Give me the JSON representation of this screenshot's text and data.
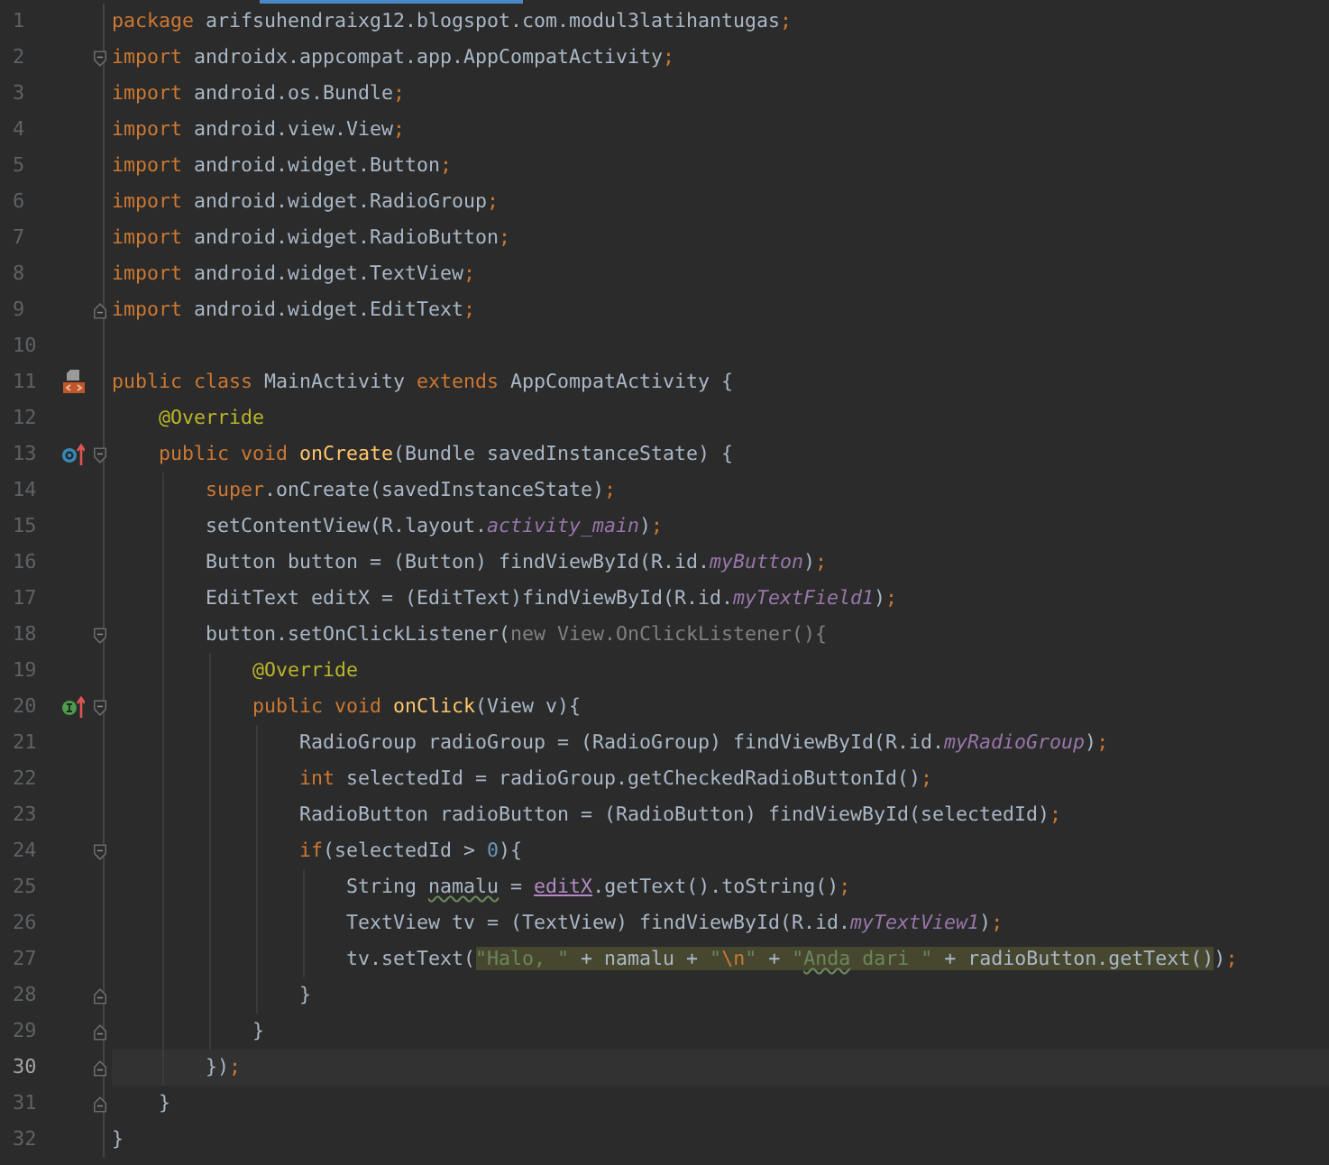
{
  "editor": {
    "lines": [
      {
        "number": "1",
        "tokens": [
          {
            "text": "package",
            "kind": "keyword"
          },
          {
            "text": " arifsuhendraixg12.blogspot.com.modul3latihantugas",
            "kind": "plain"
          },
          {
            "text": ";",
            "kind": "keyword"
          }
        ]
      },
      {
        "number": "2",
        "fold": {
          "kind": "start"
        },
        "tokens": [
          {
            "text": "import",
            "kind": "keyword"
          },
          {
            "text": " androidx.appcompat.app.AppCompatActivity",
            "kind": "plain"
          },
          {
            "text": ";",
            "kind": "keyword"
          }
        ]
      },
      {
        "number": "3",
        "tokens": [
          {
            "text": "import",
            "kind": "keyword"
          },
          {
            "text": " android.os.Bundle",
            "kind": "plain"
          },
          {
            "text": ";",
            "kind": "keyword"
          }
        ]
      },
      {
        "number": "4",
        "tokens": [
          {
            "text": "import",
            "kind": "keyword"
          },
          {
            "text": " android.view.View",
            "kind": "plain"
          },
          {
            "text": ";",
            "kind": "keyword"
          }
        ]
      },
      {
        "number": "5",
        "tokens": [
          {
            "text": "import",
            "kind": "keyword"
          },
          {
            "text": " android.widget.Button",
            "kind": "plain"
          },
          {
            "text": ";",
            "kind": "keyword"
          }
        ]
      },
      {
        "number": "6",
        "tokens": [
          {
            "text": "import",
            "kind": "keyword"
          },
          {
            "text": " android.widget.RadioGroup",
            "kind": "plain"
          },
          {
            "text": ";",
            "kind": "keyword"
          }
        ]
      },
      {
        "number": "7",
        "tokens": [
          {
            "text": "import",
            "kind": "keyword"
          },
          {
            "text": " android.widget.RadioButton",
            "kind": "plain"
          },
          {
            "text": ";",
            "kind": "keyword"
          }
        ]
      },
      {
        "number": "8",
        "tokens": [
          {
            "text": "import",
            "kind": "keyword"
          },
          {
            "text": " android.widget.TextView",
            "kind": "plain"
          },
          {
            "text": ";",
            "kind": "keyword"
          }
        ]
      },
      {
        "number": "9",
        "fold": {
          "kind": "end"
        },
        "tokens": [
          {
            "text": "import",
            "kind": "keyword"
          },
          {
            "text": " android.widget.EditText",
            "kind": "plain"
          },
          {
            "text": ";",
            "kind": "keyword"
          }
        ]
      },
      {
        "number": "10"
      },
      {
        "number": "11",
        "marker": {
          "kind": "layout"
        },
        "tokens": [
          {
            "text": "public class ",
            "kind": "keyword"
          },
          {
            "text": "MainActivity ",
            "kind": "plain"
          },
          {
            "text": "extends ",
            "kind": "keyword"
          },
          {
            "text": "AppCompatActivity {",
            "kind": "plain"
          }
        ]
      },
      {
        "number": "12",
        "tokens": [
          {
            "text": "    @Override",
            "kind": "annotation"
          }
        ]
      },
      {
        "number": "13",
        "marker": {
          "kind": "override"
        },
        "fold": {
          "kind": "start"
        },
        "tokens": [
          {
            "text": "    public void ",
            "kind": "keyword"
          },
          {
            "text": "onCreate",
            "kind": "method"
          },
          {
            "text": "(Bundle savedInstanceState) {",
            "kind": "plain"
          }
        ]
      },
      {
        "number": "14",
        "tokens": [
          {
            "text": "        super",
            "kind": "keyword"
          },
          {
            "text": ".onCreate(savedInstanceState)",
            "kind": "plain"
          },
          {
            "text": ";",
            "kind": "keyword"
          }
        ]
      },
      {
        "number": "15",
        "tokens": [
          {
            "text": "        setContentView(R.layout.",
            "kind": "plain"
          },
          {
            "text": "activity_main",
            "kind": "field"
          },
          {
            "text": ")",
            "kind": "plain"
          },
          {
            "text": ";",
            "kind": "keyword"
          }
        ]
      },
      {
        "number": "16",
        "tokens": [
          {
            "text": "        Button button = (Button) findViewById(R.id.",
            "kind": "plain"
          },
          {
            "text": "myButton",
            "kind": "field"
          },
          {
            "text": ")",
            "kind": "plain"
          },
          {
            "text": ";",
            "kind": "keyword"
          }
        ]
      },
      {
        "number": "17",
        "tokens": [
          {
            "text": "        EditText editX = (EditText)findViewById(R.id.",
            "kind": "plain"
          },
          {
            "text": "myTextField1",
            "kind": "field"
          },
          {
            "text": ")",
            "kind": "plain"
          },
          {
            "text": ";",
            "kind": "keyword"
          }
        ]
      },
      {
        "number": "18",
        "fold": {
          "kind": "start"
        },
        "tokens": [
          {
            "text": "        button.setOnClickListener(",
            "kind": "plain"
          },
          {
            "text": "new View.OnClickListener(){",
            "kind": "faded"
          }
        ]
      },
      {
        "number": "19",
        "tokens": [
          {
            "text": "            @Override",
            "kind": "annotation"
          }
        ]
      },
      {
        "number": "20",
        "marker": {
          "kind": "implement"
        },
        "fold": {
          "kind": "start"
        },
        "tokens": [
          {
            "text": "            public void ",
            "kind": "keyword"
          },
          {
            "text": "onClick",
            "kind": "method"
          },
          {
            "text": "(View v){",
            "kind": "plain"
          }
        ]
      },
      {
        "number": "21",
        "tokens": [
          {
            "text": "                RadioGroup radioGroup = (RadioGroup) findViewById(R.id.",
            "kind": "plain"
          },
          {
            "text": "myRadioGroup",
            "kind": "field"
          },
          {
            "text": ")",
            "kind": "plain"
          },
          {
            "text": ";",
            "kind": "keyword"
          }
        ]
      },
      {
        "number": "22",
        "tokens": [
          {
            "text": "                int ",
            "kind": "keyword"
          },
          {
            "text": "selectedId = radioGroup.getCheckedRadioButtonId()",
            "kind": "plain"
          },
          {
            "text": ";",
            "kind": "keyword"
          }
        ]
      },
      {
        "number": "23",
        "tokens": [
          {
            "text": "                RadioButton radioButton = (RadioButton) findViewById(selectedId)",
            "kind": "plain"
          },
          {
            "text": ";",
            "kind": "keyword"
          }
        ]
      },
      {
        "number": "24",
        "fold": {
          "kind": "start"
        },
        "tokens": [
          {
            "text": "                if",
            "kind": "keyword"
          },
          {
            "text": "(selectedId > ",
            "kind": "plain"
          },
          {
            "text": "0",
            "kind": "number"
          },
          {
            "text": "){",
            "kind": "plain"
          }
        ]
      },
      {
        "number": "25",
        "tokens": [
          {
            "text": "                    String ",
            "kind": "plain"
          },
          {
            "text": "namalu",
            "kind": "plain",
            "typo": true
          },
          {
            "text": " = ",
            "kind": "plain"
          },
          {
            "text": "editX",
            "kind": "captured"
          },
          {
            "text": ".getText().toString()",
            "kind": "plain"
          },
          {
            "text": ";",
            "kind": "keyword"
          }
        ]
      },
      {
        "number": "26",
        "tokens": [
          {
            "text": "                    TextView tv = (TextView) findViewById(R.id.",
            "kind": "plain"
          },
          {
            "text": "myTextView1",
            "kind": "field"
          },
          {
            "text": ")",
            "kind": "plain"
          },
          {
            "text": ";",
            "kind": "keyword"
          }
        ]
      },
      {
        "number": "27",
        "tokens": [
          {
            "text": "                    tv.setText(",
            "kind": "plain"
          },
          {
            "text": "\"Halo, \"",
            "kind": "string",
            "highlighted": true
          },
          {
            "text": " + namalu + ",
            "kind": "plain",
            "highlighted": true
          },
          {
            "text": "\"",
            "kind": "string",
            "highlighted": true
          },
          {
            "text": "\\n",
            "kind": "escape",
            "highlighted": true
          },
          {
            "text": "\"",
            "kind": "string",
            "highlighted": true
          },
          {
            "text": " + ",
            "kind": "plain",
            "highlighted": true
          },
          {
            "text": "\"",
            "kind": "string",
            "highlighted": true
          },
          {
            "text": "Anda",
            "kind": "string",
            "typo": true,
            "highlighted": true
          },
          {
            "text": " dari \"",
            "kind": "string",
            "highlighted": true
          },
          {
            "text": " + radioButton.getText()",
            "kind": "plain",
            "highlighted": true
          },
          {
            "text": ")",
            "kind": "plain"
          },
          {
            "text": ";",
            "kind": "keyword"
          }
        ]
      },
      {
        "number": "28",
        "fold": {
          "kind": "end"
        },
        "tokens": [
          {
            "text": "                }",
            "kind": "plain"
          }
        ]
      },
      {
        "number": "29",
        "fold": {
          "kind": "end"
        },
        "tokens": [
          {
            "text": "            }",
            "kind": "plain"
          }
        ]
      },
      {
        "number": "30",
        "fold": {
          "kind": "end"
        },
        "current": true,
        "tokens": [
          {
            "text": "        })",
            "kind": "plain"
          },
          {
            "text": ";",
            "kind": "keyword"
          }
        ]
      },
      {
        "number": "31",
        "fold": {
          "kind": "end"
        },
        "tokens": [
          {
            "text": "    }",
            "kind": "plain"
          }
        ]
      },
      {
        "number": "32",
        "tokens": [
          {
            "text": "}",
            "kind": "plain"
          }
        ]
      }
    ]
  }
}
